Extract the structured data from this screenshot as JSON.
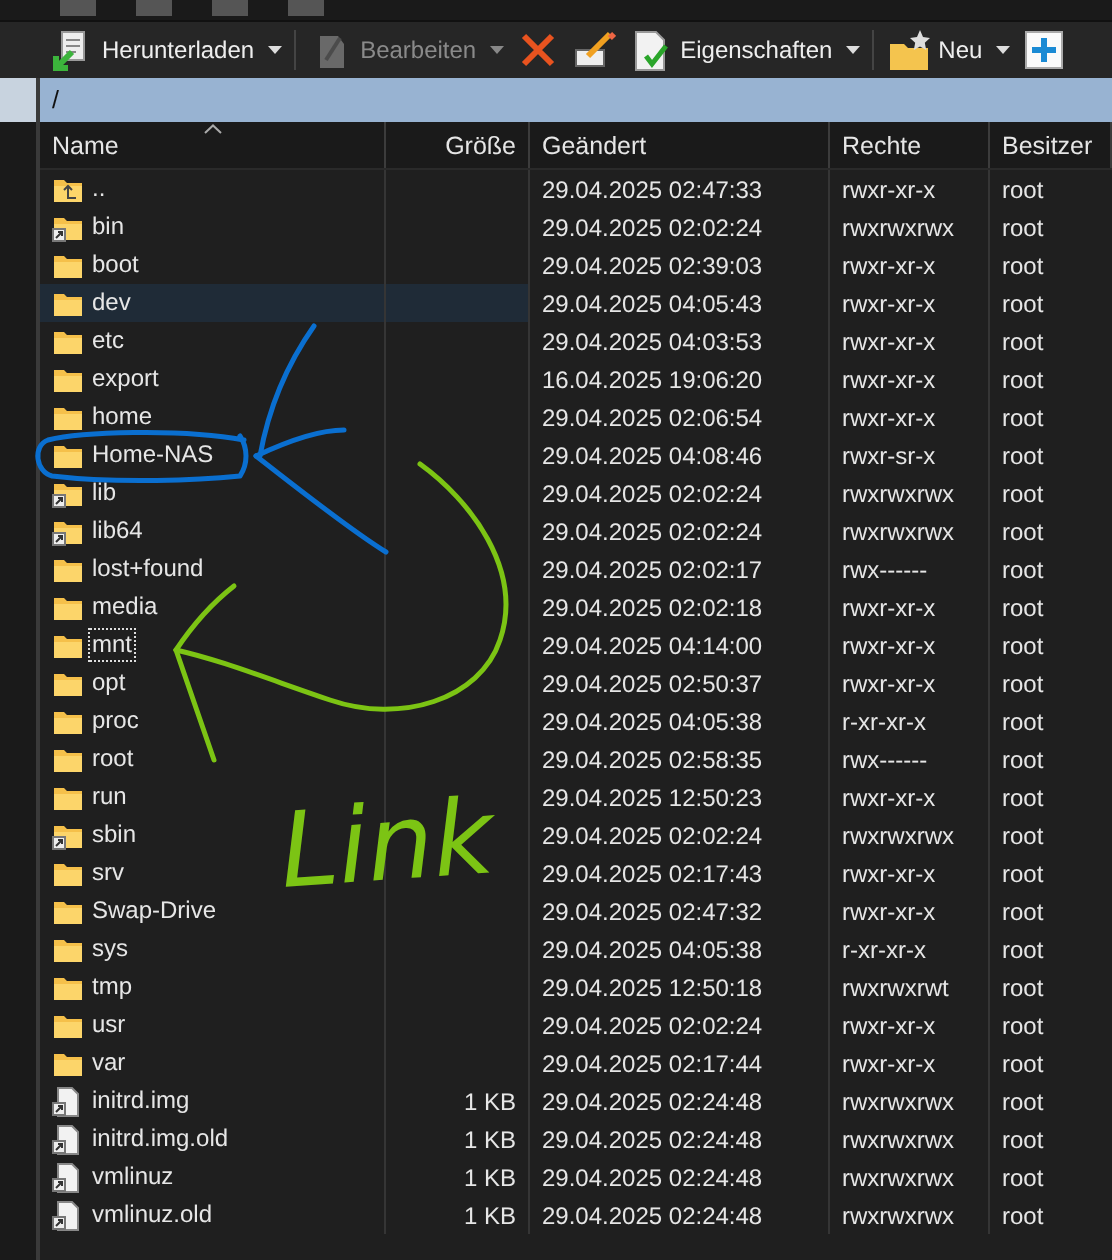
{
  "toolbar": [
    {
      "kind": "download",
      "label": "Herunterladen",
      "dropdown": true,
      "disabled": false
    },
    {
      "kind": "edit",
      "label": "Bearbeiten",
      "dropdown": true,
      "disabled": true
    },
    {
      "kind": "delete",
      "dropdown": false,
      "disabled": false
    },
    {
      "kind": "rename",
      "dropdown": false,
      "disabled": false
    },
    {
      "kind": "properties",
      "label": "Eigenschaften",
      "dropdown": true,
      "disabled": false
    },
    {
      "kind": "new",
      "label": "Neu",
      "dropdown": true,
      "disabled": false
    },
    {
      "kind": "add",
      "dropdown": false,
      "disabled": false
    }
  ],
  "path": "/",
  "columns": [
    {
      "label": "Name",
      "sorted": true
    },
    {
      "label": "Größe",
      "sorted": false
    },
    {
      "label": "Geändert",
      "sorted": false
    },
    {
      "label": "Rechte",
      "sorted": false
    },
    {
      "label": "Besitzer",
      "sorted": false
    }
  ],
  "rows": [
    {
      "kind": "parent",
      "name": "..",
      "modified": "29.04.2025 02:47:33",
      "rights": "rwxr-xr-x",
      "owner": "root",
      "hovered": false,
      "focused": false
    },
    {
      "kind": "folder-link",
      "name": "bin",
      "modified": "29.04.2025 02:02:24",
      "rights": "rwxrwxrwx",
      "owner": "root",
      "hovered": false,
      "focused": false
    },
    {
      "kind": "folder",
      "name": "boot",
      "modified": "29.04.2025 02:39:03",
      "rights": "rwxr-xr-x",
      "owner": "root",
      "hovered": false,
      "focused": false
    },
    {
      "kind": "folder",
      "name": "dev",
      "modified": "29.04.2025 04:05:43",
      "rights": "rwxr-xr-x",
      "owner": "root",
      "hovered": true,
      "focused": false
    },
    {
      "kind": "folder",
      "name": "etc",
      "modified": "29.04.2025 04:03:53",
      "rights": "rwxr-xr-x",
      "owner": "root",
      "hovered": false,
      "focused": false
    },
    {
      "kind": "folder",
      "name": "export",
      "modified": "16.04.2025 19:06:20",
      "rights": "rwxr-xr-x",
      "owner": "root",
      "hovered": false,
      "focused": false
    },
    {
      "kind": "folder",
      "name": "home",
      "modified": "29.04.2025 02:06:54",
      "rights": "rwxr-xr-x",
      "owner": "root",
      "hovered": false,
      "focused": false
    },
    {
      "kind": "folder",
      "name": "Home-NAS",
      "modified": "29.04.2025 04:08:46",
      "rights": "rwxr-sr-x",
      "owner": "root",
      "hovered": false,
      "focused": false
    },
    {
      "kind": "folder-link",
      "name": "lib",
      "modified": "29.04.2025 02:02:24",
      "rights": "rwxrwxrwx",
      "owner": "root",
      "hovered": false,
      "focused": false
    },
    {
      "kind": "folder-link",
      "name": "lib64",
      "modified": "29.04.2025 02:02:24",
      "rights": "rwxrwxrwx",
      "owner": "root",
      "hovered": false,
      "focused": false
    },
    {
      "kind": "folder",
      "name": "lost+found",
      "modified": "29.04.2025 02:02:17",
      "rights": "rwx------",
      "owner": "root",
      "hovered": false,
      "focused": false
    },
    {
      "kind": "folder",
      "name": "media",
      "modified": "29.04.2025 02:02:18",
      "rights": "rwxr-xr-x",
      "owner": "root",
      "hovered": false,
      "focused": false
    },
    {
      "kind": "folder",
      "name": "mnt",
      "modified": "29.04.2025 04:14:00",
      "rights": "rwxr-xr-x",
      "owner": "root",
      "hovered": false,
      "focused": true
    },
    {
      "kind": "folder",
      "name": "opt",
      "modified": "29.04.2025 02:50:37",
      "rights": "rwxr-xr-x",
      "owner": "root",
      "hovered": false,
      "focused": false
    },
    {
      "kind": "folder",
      "name": "proc",
      "modified": "29.04.2025 04:05:38",
      "rights": "r-xr-xr-x",
      "owner": "root",
      "hovered": false,
      "focused": false
    },
    {
      "kind": "folder",
      "name": "root",
      "modified": "29.04.2025 02:58:35",
      "rights": "rwx------",
      "owner": "root",
      "hovered": false,
      "focused": false
    },
    {
      "kind": "folder",
      "name": "run",
      "modified": "29.04.2025 12:50:23",
      "rights": "rwxr-xr-x",
      "owner": "root",
      "hovered": false,
      "focused": false
    },
    {
      "kind": "folder-link",
      "name": "sbin",
      "modified": "29.04.2025 02:02:24",
      "rights": "rwxrwxrwx",
      "owner": "root",
      "hovered": false,
      "focused": false
    },
    {
      "kind": "folder",
      "name": "srv",
      "modified": "29.04.2025 02:17:43",
      "rights": "rwxr-xr-x",
      "owner": "root",
      "hovered": false,
      "focused": false
    },
    {
      "kind": "folder",
      "name": "Swap-Drive",
      "modified": "29.04.2025 02:47:32",
      "rights": "rwxr-xr-x",
      "owner": "root",
      "hovered": false,
      "focused": false
    },
    {
      "kind": "folder",
      "name": "sys",
      "modified": "29.04.2025 04:05:38",
      "rights": "r-xr-xr-x",
      "owner": "root",
      "hovered": false,
      "focused": false
    },
    {
      "kind": "folder",
      "name": "tmp",
      "modified": "29.04.2025 12:50:18",
      "rights": "rwxrwxrwt",
      "owner": "root",
      "hovered": false,
      "focused": false
    },
    {
      "kind": "folder",
      "name": "usr",
      "modified": "29.04.2025 02:02:24",
      "rights": "rwxr-xr-x",
      "owner": "root",
      "hovered": false,
      "focused": false
    },
    {
      "kind": "folder",
      "name": "var",
      "modified": "29.04.2025 02:17:44",
      "rights": "rwxr-xr-x",
      "owner": "root",
      "hovered": false,
      "focused": false
    },
    {
      "kind": "file-link",
      "name": "initrd.img",
      "size": "1 KB",
      "modified": "29.04.2025 02:24:48",
      "rights": "rwxrwxrwx",
      "owner": "root",
      "hovered": false,
      "focused": false
    },
    {
      "kind": "file-link",
      "name": "initrd.img.old",
      "size": "1 KB",
      "modified": "29.04.2025 02:24:48",
      "rights": "rwxrwxrwx",
      "owner": "root",
      "hovered": false,
      "focused": false
    },
    {
      "kind": "file-link",
      "name": "vmlinuz",
      "size": "1 KB",
      "modified": "29.04.2025 02:24:48",
      "rights": "rwxrwxrwx",
      "owner": "root",
      "hovered": false,
      "focused": false
    },
    {
      "kind": "file-link",
      "name": "vmlinuz.old",
      "size": "1 KB",
      "modified": "29.04.2025 02:24:48",
      "rights": "rwxrwxrwx",
      "owner": "root",
      "hovered": false,
      "focused": false
    }
  ],
  "annotations": [
    {
      "kind": "circle-arrow",
      "color": "#0a6fd0"
    },
    {
      "kind": "curved-arrow",
      "color": "#7cc414"
    },
    {
      "kind": "label",
      "text": "Link",
      "color": "#7cc414"
    }
  ]
}
